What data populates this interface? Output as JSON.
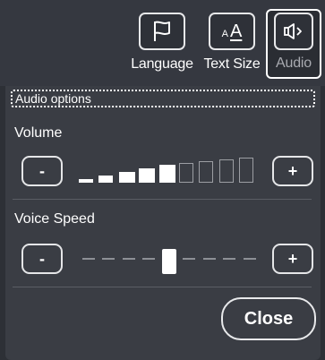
{
  "toolbar": {
    "language_label": "Language",
    "text_size_label": "Text Size",
    "text_size_glyph_small": "A",
    "text_size_glyph_big": "A",
    "audio_label": "Audio",
    "audio_selected": true
  },
  "panel": {
    "header": "Audio options",
    "volume": {
      "title": "Volume",
      "decrease_label": "-",
      "increase_label": "+",
      "level": 5,
      "max": 9
    },
    "voice_speed": {
      "title": "Voice Speed",
      "decrease_label": "-",
      "increase_label": "+",
      "position": 5,
      "steps": 9
    },
    "close_label": "Close"
  },
  "colors": {
    "background": "#2d3036",
    "panel": "#3a3d44",
    "text": "#ffffff"
  }
}
